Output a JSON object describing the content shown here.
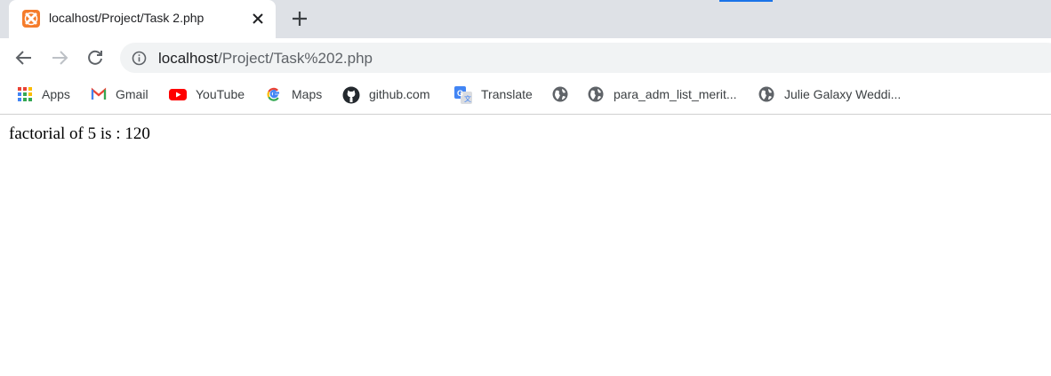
{
  "tab": {
    "title": "localhost/Project/Task 2.php"
  },
  "colors": {
    "tabstrip": "#dee1e6",
    "favicon": "#f57c2b",
    "accent": "#1a73e8"
  },
  "omnibox": {
    "host": "localhost",
    "path": "/Project/Task%202.php"
  },
  "bookmarks": [
    {
      "label": "Apps",
      "icon": "apps-grid-icon"
    },
    {
      "label": "Gmail",
      "icon": "gmail-icon"
    },
    {
      "label": "YouTube",
      "icon": "youtube-icon"
    },
    {
      "label": "Maps",
      "icon": "google-g-icon"
    },
    {
      "label": "github.com",
      "icon": "github-icon"
    },
    {
      "label": "Translate",
      "icon": "translate-icon"
    },
    {
      "label": "",
      "icon": "globe-icon"
    },
    {
      "label": "para_adm_list_merit...",
      "icon": "globe-icon"
    },
    {
      "label": "Julie Galaxy Weddi...",
      "icon": "globe-icon"
    }
  ],
  "page": {
    "text": "factorial of 5 is : 120"
  }
}
